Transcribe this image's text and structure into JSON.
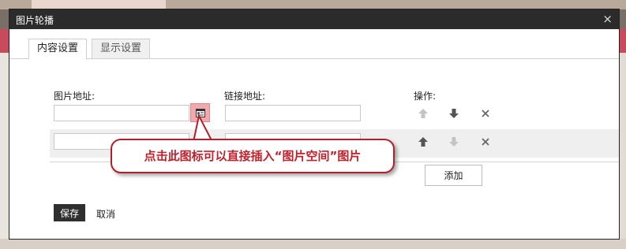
{
  "dialog": {
    "title": "图片轮播",
    "close_label": "×"
  },
  "tabs": [
    {
      "label": "内容设置",
      "active": true
    },
    {
      "label": "显示设置",
      "active": false
    }
  ],
  "columns": {
    "image_address": "图片地址:",
    "link_address": "链接地址:",
    "operations": "操作:"
  },
  "rows": [
    {
      "image_url": "",
      "link_url": "",
      "up_enabled": false,
      "down_enabled": true
    },
    {
      "image_url": "",
      "link_url": "",
      "up_enabled": true,
      "down_enabled": false
    }
  ],
  "tooltip": {
    "text": "点击此图标可以直接插入“图片空间”图片"
  },
  "buttons": {
    "add": "添加",
    "save": "保存",
    "cancel": "取消"
  },
  "icons": {
    "image_picker": "image-picker-icon",
    "move_up": "arrow-up-icon",
    "move_down": "arrow-down-icon",
    "delete": "delete-x-icon"
  },
  "colors": {
    "title_bar": "#2b2b2b",
    "picker_button": "#f2a9ad",
    "callout_border": "#b0212b",
    "callout_text": "#c0222d",
    "save_button": "#2f2f2f"
  }
}
